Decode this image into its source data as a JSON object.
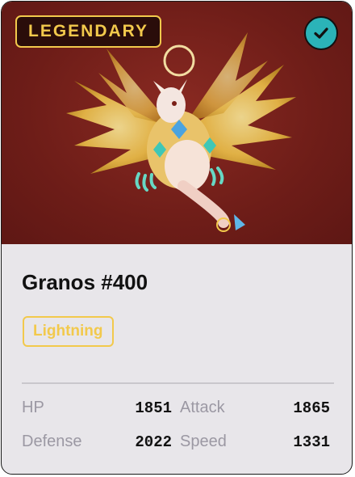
{
  "card": {
    "rarity": "LEGENDARY",
    "name": "Granos #400",
    "element": "Lightning",
    "verified_icon": "check-icon",
    "stats": [
      {
        "label": "HP",
        "value": "1851"
      },
      {
        "label": "Attack",
        "value": "1865"
      },
      {
        "label": "Defense",
        "value": "2022"
      },
      {
        "label": "Speed",
        "value": "1331"
      }
    ]
  },
  "colors": {
    "hero_bg": "#6e1d18",
    "gold": "#f2c94c",
    "verified": "#2bb3b8",
    "panel": "#e8e6ea"
  }
}
